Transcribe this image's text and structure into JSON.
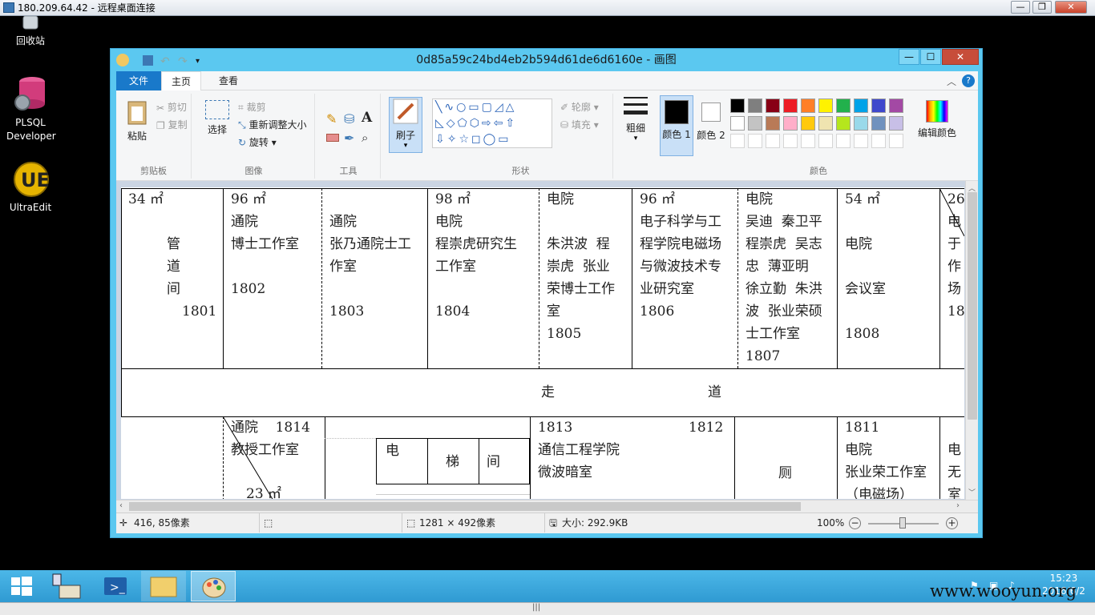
{
  "rdp": {
    "title": "180.209.64.42 - 远程桌面连接",
    "min": "—",
    "restore": "❐",
    "close": "✕"
  },
  "desktop_icons": [
    {
      "label": "回收站"
    },
    {
      "label": "PLSQL Developer"
    },
    {
      "label": "UltraEdit"
    }
  ],
  "paint": {
    "title": "0d85a59c24bd4eb2b594d61de6d6160e - 画图",
    "win_min": "—",
    "win_max": "☐",
    "win_close": "✕",
    "tabs": {
      "file": "文件",
      "home": "主页",
      "view": "查看"
    },
    "clipboard": {
      "paste": "粘贴",
      "cut": "剪切",
      "copy": "复制",
      "group": "剪贴板"
    },
    "image": {
      "select": "选择",
      "crop": "裁剪",
      "resize": "重新调整大小",
      "rotate": "旋转",
      "group": "图像"
    },
    "tools": {
      "group": "工具"
    },
    "brushes": {
      "label": "刷子"
    },
    "shapes": {
      "outline": "轮廓",
      "fill": "填充",
      "group": "形状"
    },
    "size": {
      "label": "粗细"
    },
    "colors": {
      "color1": "颜色 1",
      "color2": "颜色 2",
      "edit": "编辑颜色",
      "group": "颜色",
      "palette": [
        "#000000",
        "#7f7f7f",
        "#880015",
        "#ed1c24",
        "#ff7f27",
        "#fff200",
        "#22b14c",
        "#00a2e8",
        "#3f48cc",
        "#a349a4",
        "#ffffff",
        "#c3c3c3",
        "#b97a57",
        "#ffaec9",
        "#ffc90e",
        "#efe4b0",
        "#b5e61d",
        "#99d9ea",
        "#7092be",
        "#c8bfe7"
      ]
    }
  },
  "canvas": {
    "c1": {
      "area": "34 ㎡",
      "name": "管\n道\n间",
      "num": "1801"
    },
    "c2": {
      "text": "96 ㎡\n通院\n博士工作室\n\n1802"
    },
    "c3": {
      "text": "通院\n张乃通院士工\n作室\n\n1803"
    },
    "c4": {
      "text": "98 ㎡\n电院\n程崇虎研究生\n工作室\n\n1804"
    },
    "c5": {
      "text": "电院\n\n朱洪波  程\n崇虎  张业\n荣博士工作\n室\n1805"
    },
    "c6": {
      "text": "96 ㎡\n电子科学与工\n程学院电磁场\n与微波技术专\n业研究室\n1806"
    },
    "c7": {
      "text": "电院\n吴迪  秦卫平\n程崇虎  吴志\n忠  薄亚明\n徐立勤  朱洪\n波  张业荣硕\n士工作室\n1807"
    },
    "c8": {
      "text": "54 ㎡\n\n电院\n\n会议室\n\n1808"
    },
    "c9": {
      "text": "26\n电\n于\n作\n场\n18"
    },
    "corridor": {
      "left": "走",
      "right": "道"
    },
    "b1": {
      "text": "通院    1814\n教授工作室"
    },
    "b1_area": "23 ㎡",
    "elevator": {
      "a": "电",
      "b": "梯",
      "c": "间"
    },
    "b2": {
      "num1": "1813",
      "num2": "1812",
      "text": "通信工程学院\n微波暗室"
    },
    "toilet": "厕",
    "b3": {
      "text": "1811\n电院\n张业荣工作室\n（电磁场）"
    },
    "b4": {
      "text": "电\n无\n室"
    }
  },
  "status": {
    "cursor": "416, 85像素",
    "dims": "1281 × 492像素",
    "size": "大小: 292.9KB",
    "zoom": "100%"
  },
  "taskbar": {
    "time": "15:23",
    "date": "2016/6/2"
  },
  "watermark": "www.wooyun.org"
}
